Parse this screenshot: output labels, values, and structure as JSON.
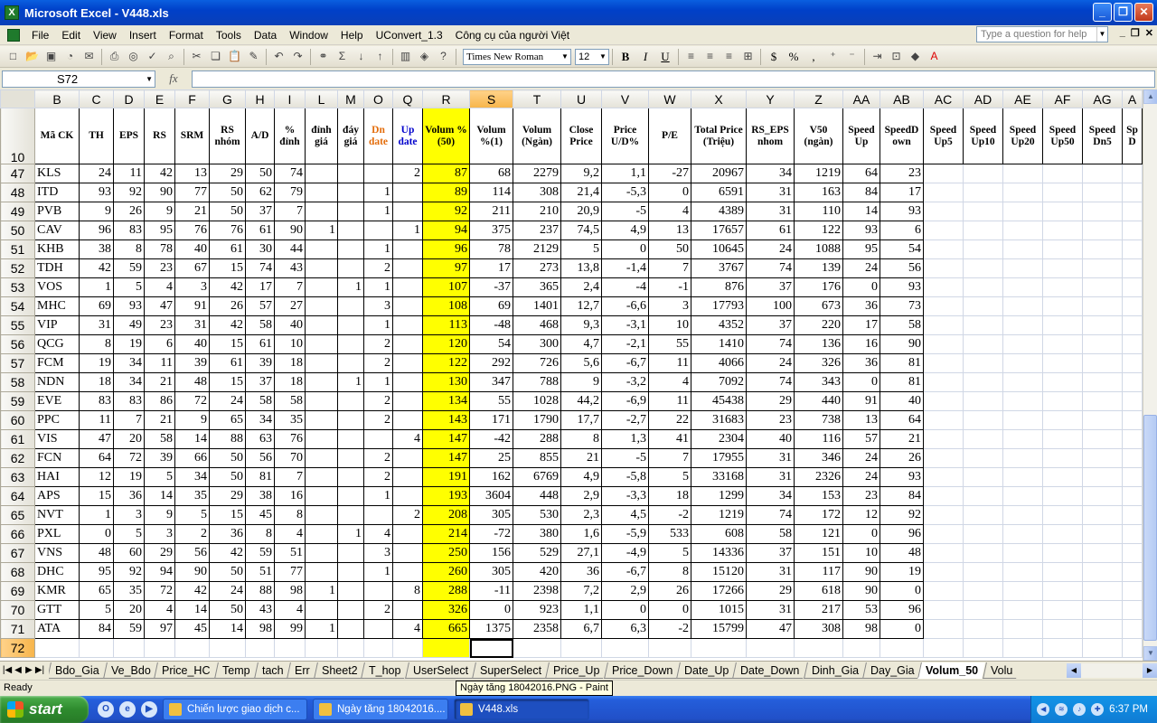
{
  "window": {
    "title": "Microsoft Excel - V448.xls"
  },
  "menu": [
    "File",
    "Edit",
    "View",
    "Insert",
    "Format",
    "Tools",
    "Data",
    "Window",
    "Help",
    "UConvert_1.3",
    "Công cụ của người Việt"
  ],
  "ask_placeholder": "Type a question for help",
  "toolbar": {
    "font": "Times New Roman",
    "size": "12",
    "bold": "B",
    "italic": "I",
    "underline": "U",
    "currency": "$",
    "percent": "%",
    "comma": ","
  },
  "formula": {
    "cell_ref": "S72",
    "fx": "fx",
    "content": ""
  },
  "columns": [
    "B",
    "C",
    "D",
    "E",
    "F",
    "G",
    "H",
    "I",
    "L",
    "M",
    "O",
    "Q",
    "R",
    "S",
    "T",
    "U",
    "V",
    "W",
    "X",
    "Y",
    "Z",
    "AA",
    "AB",
    "AC",
    "AD",
    "AE",
    "AF",
    "AG",
    "A"
  ],
  "header_row": {
    "row_number": "10",
    "labels": [
      "Mã CK",
      "TH",
      "EPS",
      "RS",
      "SRM",
      "RS nhóm",
      "A/D",
      "% đỉnh",
      "đỉnh giá",
      "đáy giá",
      "Dn date",
      "Up date",
      "Volum %(50)",
      "Volum %(1)",
      "Volum (Ngàn)",
      "Close Price",
      "Price U/D%",
      "P/E",
      "Total Price (Triệu)",
      "RS_EPS nhom",
      "V50 (ngàn)",
      "Speed Up",
      "SpeedD own",
      "Speed Up5",
      "Speed Up10",
      "Speed Up20",
      "Speed Up50",
      "Speed Dn5",
      "Sp D"
    ]
  },
  "rows": [
    {
      "n": "47",
      "v": [
        "KLS",
        "24",
        "11",
        "42",
        "13",
        "29",
        "50",
        "74",
        "",
        "",
        "",
        "2",
        "87",
        "68",
        "2279",
        "9,2",
        "1,1",
        "-27",
        "20967",
        "34",
        "1219",
        "64",
        "23"
      ]
    },
    {
      "n": "48",
      "v": [
        "ITD",
        "93",
        "92",
        "90",
        "77",
        "50",
        "62",
        "79",
        "",
        "",
        "1",
        "",
        "89",
        "114",
        "308",
        "21,4",
        "-5,3",
        "0",
        "6591",
        "31",
        "163",
        "84",
        "17"
      ]
    },
    {
      "n": "49",
      "v": [
        "PVB",
        "9",
        "26",
        "9",
        "21",
        "50",
        "37",
        "7",
        "",
        "",
        "1",
        "",
        "92",
        "211",
        "210",
        "20,9",
        "-5",
        "4",
        "4389",
        "31",
        "110",
        "14",
        "93"
      ]
    },
    {
      "n": "50",
      "v": [
        "CAV",
        "96",
        "83",
        "95",
        "76",
        "76",
        "61",
        "90",
        "1",
        "",
        "",
        "1",
        "94",
        "375",
        "237",
        "74,5",
        "4,9",
        "13",
        "17657",
        "61",
        "122",
        "93",
        "6"
      ]
    },
    {
      "n": "51",
      "v": [
        "KHB",
        "38",
        "8",
        "78",
        "40",
        "61",
        "30",
        "44",
        "",
        "",
        "1",
        "",
        "96",
        "78",
        "2129",
        "5",
        "0",
        "50",
        "10645",
        "24",
        "1088",
        "95",
        "54"
      ]
    },
    {
      "n": "52",
      "v": [
        "TDH",
        "42",
        "59",
        "23",
        "67",
        "15",
        "74",
        "43",
        "",
        "",
        "2",
        "",
        "97",
        "17",
        "273",
        "13,8",
        "-1,4",
        "7",
        "3767",
        "74",
        "139",
        "24",
        "56"
      ]
    },
    {
      "n": "53",
      "v": [
        "VOS",
        "1",
        "5",
        "4",
        "3",
        "42",
        "17",
        "7",
        "",
        "1",
        "1",
        "",
        "107",
        "-37",
        "365",
        "2,4",
        "-4",
        "-1",
        "876",
        "37",
        "176",
        "0",
        "93"
      ]
    },
    {
      "n": "54",
      "v": [
        "MHC",
        "69",
        "93",
        "47",
        "91",
        "26",
        "57",
        "27",
        "",
        "",
        "3",
        "",
        "108",
        "69",
        "1401",
        "12,7",
        "-6,6",
        "3",
        "17793",
        "100",
        "673",
        "36",
        "73"
      ]
    },
    {
      "n": "55",
      "v": [
        "VIP",
        "31",
        "49",
        "23",
        "31",
        "42",
        "58",
        "40",
        "",
        "",
        "1",
        "",
        "113",
        "-48",
        "468",
        "9,3",
        "-3,1",
        "10",
        "4352",
        "37",
        "220",
        "17",
        "58"
      ]
    },
    {
      "n": "56",
      "v": [
        "QCG",
        "8",
        "19",
        "6",
        "40",
        "15",
        "61",
        "10",
        "",
        "",
        "2",
        "",
        "120",
        "54",
        "300",
        "4,7",
        "-2,1",
        "55",
        "1410",
        "74",
        "136",
        "16",
        "90"
      ]
    },
    {
      "n": "57",
      "v": [
        "FCM",
        "19",
        "34",
        "11",
        "39",
        "61",
        "39",
        "18",
        "",
        "",
        "2",
        "",
        "122",
        "292",
        "726",
        "5,6",
        "-6,7",
        "11",
        "4066",
        "24",
        "326",
        "36",
        "81"
      ]
    },
    {
      "n": "58",
      "v": [
        "NDN",
        "18",
        "34",
        "21",
        "48",
        "15",
        "37",
        "18",
        "",
        "1",
        "1",
        "",
        "130",
        "347",
        "788",
        "9",
        "-3,2",
        "4",
        "7092",
        "74",
        "343",
        "0",
        "81"
      ]
    },
    {
      "n": "59",
      "v": [
        "EVE",
        "83",
        "83",
        "86",
        "72",
        "24",
        "58",
        "58",
        "",
        "",
        "2",
        "",
        "134",
        "55",
        "1028",
        "44,2",
        "-6,9",
        "11",
        "45438",
        "29",
        "440",
        "91",
        "40"
      ]
    },
    {
      "n": "60",
      "v": [
        "PPC",
        "11",
        "7",
        "21",
        "9",
        "65",
        "34",
        "35",
        "",
        "",
        "2",
        "",
        "143",
        "171",
        "1790",
        "17,7",
        "-2,7",
        "22",
        "31683",
        "23",
        "738",
        "13",
        "64"
      ]
    },
    {
      "n": "61",
      "v": [
        "VIS",
        "47",
        "20",
        "58",
        "14",
        "88",
        "63",
        "76",
        "",
        "",
        "",
        "4",
        "147",
        "-42",
        "288",
        "8",
        "1,3",
        "41",
        "2304",
        "40",
        "116",
        "57",
        "21"
      ]
    },
    {
      "n": "62",
      "v": [
        "FCN",
        "64",
        "72",
        "39",
        "66",
        "50",
        "56",
        "70",
        "",
        "",
        "2",
        "",
        "147",
        "25",
        "855",
        "21",
        "-5",
        "7",
        "17955",
        "31",
        "346",
        "24",
        "26"
      ]
    },
    {
      "n": "63",
      "v": [
        "HAI",
        "12",
        "19",
        "5",
        "34",
        "50",
        "81",
        "7",
        "",
        "",
        "2",
        "",
        "191",
        "162",
        "6769",
        "4,9",
        "-5,8",
        "5",
        "33168",
        "31",
        "2326",
        "24",
        "93"
      ]
    },
    {
      "n": "64",
      "v": [
        "APS",
        "15",
        "36",
        "14",
        "35",
        "29",
        "38",
        "16",
        "",
        "",
        "1",
        "",
        "193",
        "3604",
        "448",
        "2,9",
        "-3,3",
        "18",
        "1299",
        "34",
        "153",
        "23",
        "84"
      ]
    },
    {
      "n": "65",
      "v": [
        "NVT",
        "1",
        "3",
        "9",
        "5",
        "15",
        "45",
        "8",
        "",
        "",
        "",
        "2",
        "208",
        "305",
        "530",
        "2,3",
        "4,5",
        "-2",
        "1219",
        "74",
        "172",
        "12",
        "92"
      ]
    },
    {
      "n": "66",
      "v": [
        "PXL",
        "0",
        "5",
        "3",
        "2",
        "36",
        "8",
        "4",
        "",
        "1",
        "4",
        "",
        "214",
        "-72",
        "380",
        "1,6",
        "-5,9",
        "533",
        "608",
        "58",
        "121",
        "0",
        "96"
      ]
    },
    {
      "n": "67",
      "v": [
        "VNS",
        "48",
        "60",
        "29",
        "56",
        "42",
        "59",
        "51",
        "",
        "",
        "3",
        "",
        "250",
        "156",
        "529",
        "27,1",
        "-4,9",
        "5",
        "14336",
        "37",
        "151",
        "10",
        "48"
      ]
    },
    {
      "n": "68",
      "v": [
        "DHC",
        "95",
        "92",
        "94",
        "90",
        "50",
        "51",
        "77",
        "",
        "",
        "1",
        "",
        "260",
        "305",
        "420",
        "36",
        "-6,7",
        "8",
        "15120",
        "31",
        "117",
        "90",
        "19"
      ]
    },
    {
      "n": "69",
      "v": [
        "KMR",
        "65",
        "35",
        "72",
        "42",
        "24",
        "88",
        "98",
        "1",
        "",
        "",
        "8",
        "288",
        "-11",
        "2398",
        "7,2",
        "2,9",
        "26",
        "17266",
        "29",
        "618",
        "90",
        "0"
      ]
    },
    {
      "n": "70",
      "v": [
        "GTT",
        "5",
        "20",
        "4",
        "14",
        "50",
        "43",
        "4",
        "",
        "",
        "2",
        "",
        "326",
        "0",
        "923",
        "1,1",
        "0",
        "0",
        "1015",
        "31",
        "217",
        "53",
        "96"
      ]
    },
    {
      "n": "71",
      "v": [
        "ATA",
        "84",
        "59",
        "97",
        "45",
        "14",
        "98",
        "99",
        "1",
        "",
        "",
        "4",
        "665",
        "1375",
        "2358",
        "6,7",
        "6,3",
        "-2",
        "15799",
        "47",
        "308",
        "98",
        "0"
      ]
    }
  ],
  "last_row_number": "72",
  "sheet_tabs": [
    "Bdo_Gia",
    "Ve_Bdo",
    "Price_HC",
    "Temp",
    "tach",
    "Err",
    "Sheet2",
    "T_hop",
    "UserSelect",
    "SuperSelect",
    "Price_Up",
    "Price_Down",
    "Date_Up",
    "Date_Down",
    "Dinh_Gia",
    "Day_Gia",
    "Volum_50",
    "Volu"
  ],
  "active_tab": "Volum_50",
  "status": "Ready",
  "tooltip": "Ngày tăng 18042016.PNG - Paint",
  "taskbar": {
    "start": "start",
    "tasks": [
      "Chiến lược giao dịch c...",
      "Ngày tăng 18042016....",
      "V448.xls"
    ],
    "clock": "6:37 PM"
  },
  "colors": {
    "highlight_col": "#ffff00",
    "title_bar": "#0a5fe0",
    "taskbar": "#245edb",
    "start": "#2e8b2e"
  }
}
